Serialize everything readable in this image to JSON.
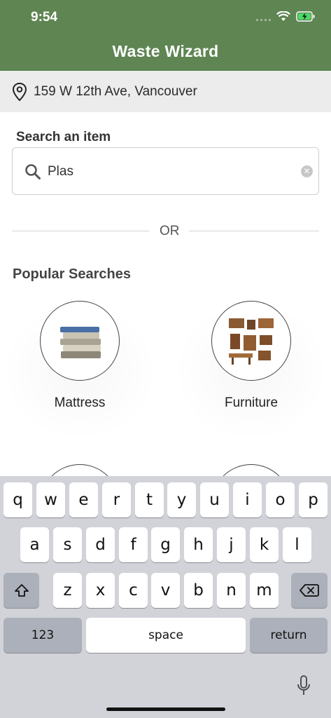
{
  "status_bar": {
    "time": "9:54"
  },
  "app": {
    "title": "Waste Wizard"
  },
  "location": {
    "address": "159 W 12th Ave, Vancouver"
  },
  "search": {
    "label": "Search an item",
    "value": "Plas",
    "clear_icon": "clear-icon"
  },
  "divider": {
    "text": "OR"
  },
  "popular": {
    "title": "Popular Searches",
    "items": [
      {
        "label": "Mattress"
      },
      {
        "label": "Furniture"
      }
    ]
  },
  "keyboard": {
    "row1": [
      "q",
      "w",
      "e",
      "r",
      "t",
      "y",
      "u",
      "i",
      "o",
      "p"
    ],
    "row2": [
      "a",
      "s",
      "d",
      "f",
      "g",
      "h",
      "j",
      "k",
      "l"
    ],
    "row3": [
      "z",
      "x",
      "c",
      "v",
      "b",
      "n",
      "m"
    ],
    "numbers_label": "123",
    "space_label": "space",
    "return_label": "return"
  },
  "colors": {
    "header": "#5e8552",
    "keyboard_bg": "#d1d3d9"
  }
}
